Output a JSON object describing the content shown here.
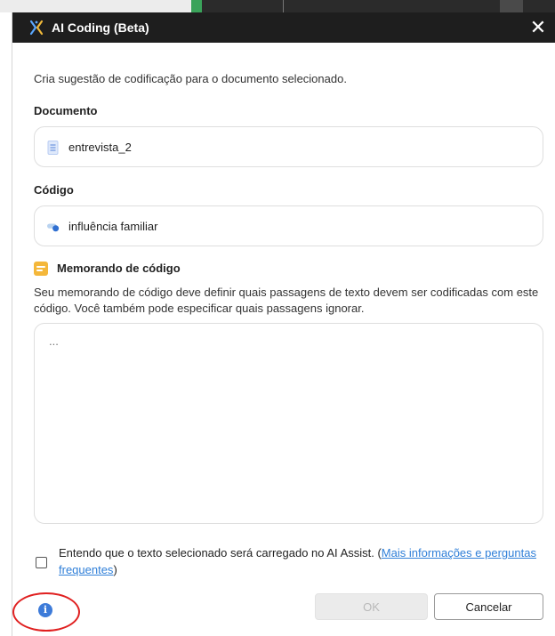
{
  "window": {
    "title": "AI Coding (Beta)",
    "close_glyph": "✕"
  },
  "description": "Cria sugestão de codificação para o documento selecionado.",
  "document": {
    "label": "Documento",
    "value": "entrevista_2",
    "icon": "document-icon"
  },
  "code": {
    "label": "Código",
    "value": "influência familiar",
    "icon": "code-tag-icon"
  },
  "memo": {
    "title": "Memorando de código",
    "icon": "memo-icon",
    "description": "Seu memorando de código deve definir quais passagens de texto devem ser codificadas com este código. Você também pode especificar quais passagens ignorar.",
    "placeholder": "..."
  },
  "consent": {
    "text": "Entendo que o texto selecionado será carregado no AI Assist. (",
    "link_text": "Mais informações e perguntas frequentes",
    "text_end": ")",
    "checked": false
  },
  "buttons": {
    "ok_label": "OK",
    "cancel_label": "Cancelar"
  },
  "colors": {
    "titlebar": "#1e1e1e",
    "accent": "#2f7fd8",
    "memo_icon": "#f4b73a",
    "annotation": "#e02020"
  }
}
